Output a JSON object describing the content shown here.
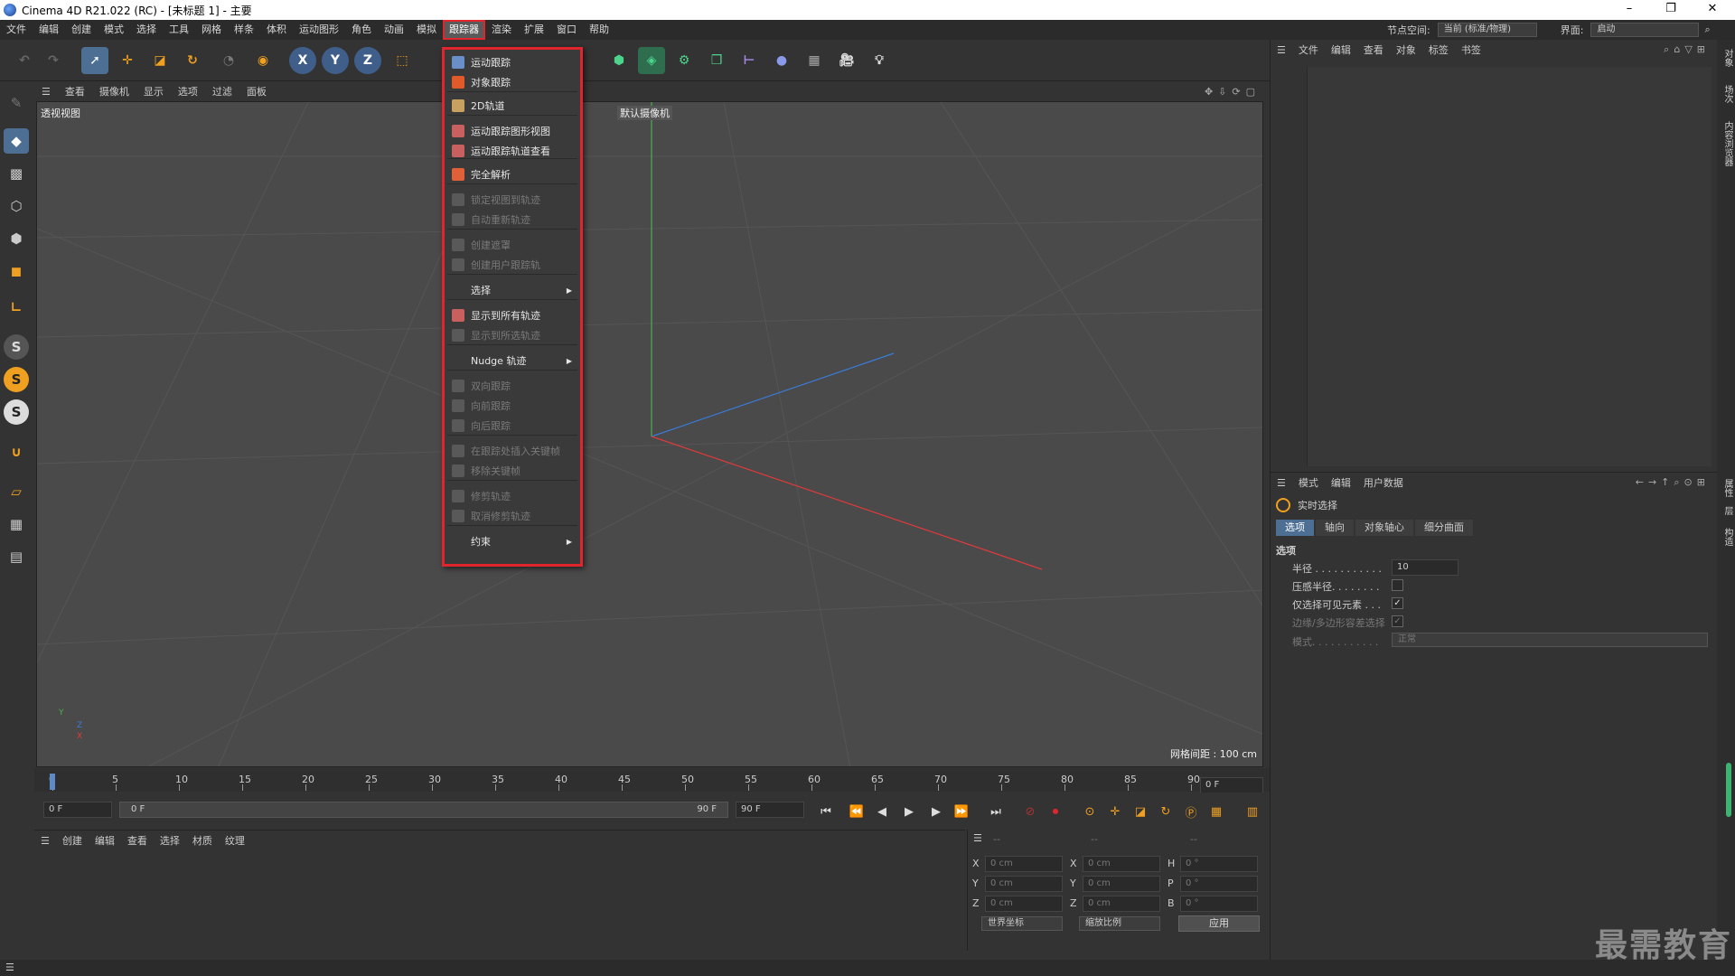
{
  "window": {
    "title": "Cinema 4D R21.022 (RC) - [未标题 1] - 主要",
    "controls": [
      "–",
      "❐",
      "✕"
    ]
  },
  "menubar": {
    "items": [
      "文件",
      "编辑",
      "创建",
      "模式",
      "选择",
      "工具",
      "网格",
      "样条",
      "体积",
      "运动图形",
      "角色",
      "动画",
      "模拟",
      "跟踪器",
      "渲染",
      "扩展",
      "窗口",
      "帮助"
    ],
    "active": "跟踪器",
    "node_space_label": "节点空间:",
    "node_space_value": "当前 (标准/物理)",
    "layout_label": "界面:",
    "layout_value": "启动"
  },
  "viewport_menu": {
    "items": [
      "查看",
      "摄像机",
      "显示",
      "选项",
      "过滤",
      "面板"
    ]
  },
  "viewport": {
    "label": "透视视图",
    "camera_label": "默认摄像机",
    "grid_spacing": "网格间距 : 100 cm",
    "axis_y": "Y",
    "axis_z": "Z",
    "axis_x": "X"
  },
  "dropdown": {
    "items": [
      {
        "label": "运动跟踪",
        "enabled": true
      },
      {
        "label": "对象跟踪",
        "enabled": true
      },
      {
        "label": "2D轨道",
        "enabled": true
      },
      {
        "label": "运动跟踪图形视图",
        "enabled": true
      },
      {
        "label": "运动跟踪轨道查看",
        "enabled": true
      },
      {
        "label": "完全解析",
        "enabled": true
      },
      {
        "label": "锁定视图到轨迹",
        "enabled": false
      },
      {
        "label": "自动重新轨迹",
        "enabled": false
      },
      {
        "label": "创建遮罩",
        "enabled": false
      },
      {
        "label": "创建用户跟踪轨",
        "enabled": false
      },
      {
        "label": "选择",
        "enabled": true,
        "submenu": true
      },
      {
        "label": "显示到所有轨迹",
        "enabled": true
      },
      {
        "label": "显示到所选轨迹",
        "enabled": false
      },
      {
        "label": "Nudge 轨迹",
        "enabled": true,
        "submenu": true
      },
      {
        "label": "双向跟踪",
        "enabled": false
      },
      {
        "label": "向前跟踪",
        "enabled": false
      },
      {
        "label": "向后跟踪",
        "enabled": false
      },
      {
        "label": "在跟踪处插入关键帧",
        "enabled": false
      },
      {
        "label": "移除关键帧",
        "enabled": false
      },
      {
        "label": "修剪轨迹",
        "enabled": false
      },
      {
        "label": "取消修剪轨迹",
        "enabled": false
      },
      {
        "label": "约束",
        "enabled": true,
        "submenu": true
      }
    ]
  },
  "timeline": {
    "ticks": [
      "0",
      "5",
      "10",
      "15",
      "20",
      "25",
      "30",
      "35",
      "40",
      "45",
      "50",
      "55",
      "60",
      "65",
      "70",
      "75",
      "80",
      "85",
      "90"
    ],
    "current_frame": "0 F"
  },
  "transport": {
    "start": "0 F",
    "range_start": "0 F",
    "range_end": "90 F",
    "end": "90 F"
  },
  "material_panel": {
    "menu": [
      "创建",
      "编辑",
      "查看",
      "选择",
      "材质",
      "纹理"
    ]
  },
  "coords": {
    "header": [
      "--",
      "--",
      "--"
    ],
    "rows": [
      {
        "a": "X",
        "av": "0 cm",
        "b": "X",
        "bv": "0 cm",
        "c": "H",
        "cv": "0 °"
      },
      {
        "a": "Y",
        "av": "0 cm",
        "b": "Y",
        "bv": "0 cm",
        "c": "P",
        "cv": "0 °"
      },
      {
        "a": "Z",
        "av": "0 cm",
        "b": "Z",
        "bv": "0 cm",
        "c": "B",
        "cv": "0 °"
      }
    ],
    "world": "世界坐标",
    "scale": "缩放比例",
    "apply": "应用"
  },
  "object_panel": {
    "menu": [
      "文件",
      "编辑",
      "查看",
      "对象",
      "标签",
      "书签"
    ]
  },
  "attr_panel": {
    "menu": [
      "模式",
      "编辑",
      "用户数据"
    ],
    "tool_name": "实时选择",
    "tabs": [
      "选项",
      "轴向",
      "对象轴心",
      "细分曲面"
    ],
    "section": "选项",
    "radius_label": "半径 . . . . . . . . . . .",
    "radius_value": "10",
    "pressure_label": "压感半径. . . . . . . .",
    "visible_only_label": "仅选择可见元素 . . .",
    "edge_label": "边缘/多边形容差选择",
    "mode_label": "模式. . . . . . . . . . .",
    "mode_value": "正常"
  },
  "right_strip": [
    "对象",
    "场次",
    "内容浏览器"
  ],
  "right_strip2": [
    "属性",
    "层",
    "构造"
  ],
  "watermark": "最需教育"
}
